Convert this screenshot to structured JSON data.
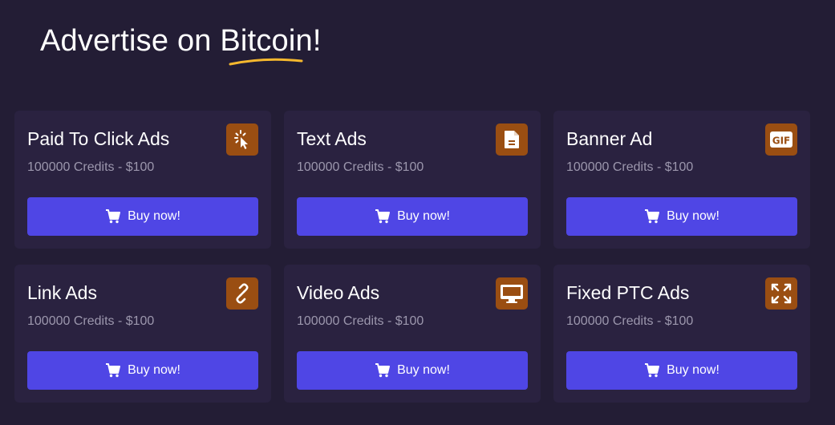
{
  "header": {
    "title_prefix": "Advertise on ",
    "title_highlight": "Bitcoin",
    "title_suffix": "!",
    "underline_color": "#f5b82e"
  },
  "colors": {
    "background": "#231d35",
    "card": "#2a2240",
    "icon_badge": "#9a4e12",
    "button": "#4f46e5",
    "muted_text": "#9c97ad"
  },
  "cards": [
    {
      "title": "Paid To Click Ads",
      "price": "100000 Credits - $100",
      "icon": "cursor-click-icon",
      "button_label": "Buy now!"
    },
    {
      "title": "Text Ads",
      "price": "100000 Credits - $100",
      "icon": "document-icon",
      "button_label": "Buy now!"
    },
    {
      "title": "Banner Ad",
      "price": "100000 Credits - $100",
      "icon": "gif-icon",
      "button_label": "Buy now!"
    },
    {
      "title": "Link Ads",
      "price": "100000 Credits - $100",
      "icon": "link-icon",
      "button_label": "Buy now!"
    },
    {
      "title": "Video Ads",
      "price": "100000 Credits - $100",
      "icon": "monitor-icon",
      "button_label": "Buy now!"
    },
    {
      "title": "Fixed PTC Ads",
      "price": "100000 Credits - $100",
      "icon": "expand-icon",
      "button_label": "Buy now!"
    }
  ]
}
